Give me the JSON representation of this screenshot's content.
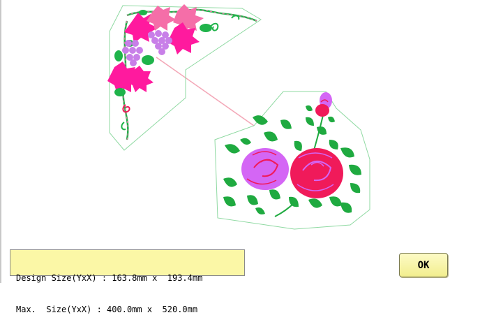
{
  "info": {
    "design_size_label": "Design Size(YxX) : 163.8mm x  193.4mm",
    "max_size_label": "Max.  Size(YxX) : 400.0mm x  520.0mm"
  },
  "buttons": {
    "ok_label": "OK"
  },
  "colors": {
    "outline": "#8fd9a2",
    "connector": "#f3a6b6",
    "grape_leaf": "#ff1a9e",
    "grape_leaf_light": "#f56ea8",
    "grapes": "#c87fe8",
    "vine_green": "#1fb34a",
    "rose_red": "#f01a5a",
    "rose_violet": "#d466f5",
    "rose_leaf": "#1faa40",
    "panel_bg": "#fbf7a6"
  }
}
